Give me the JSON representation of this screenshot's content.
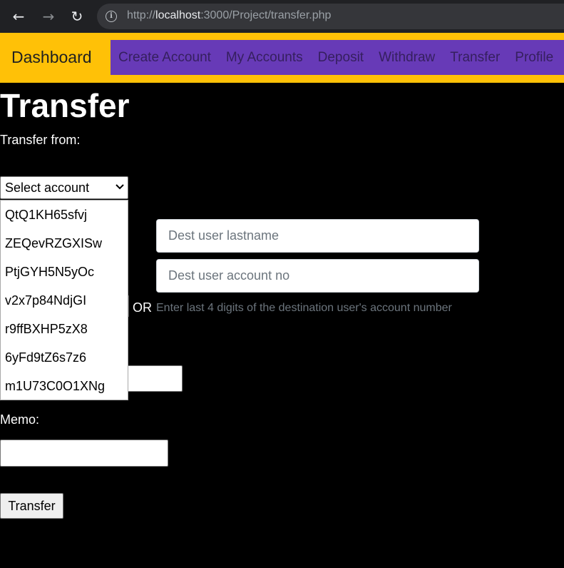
{
  "browser": {
    "back_icon": "←",
    "forward_icon": "→",
    "reload_icon": "↻",
    "url_prefix": "http://",
    "url_host": "localhost",
    "url_rest": ":3000/Project/transfer.php"
  },
  "navbar": {
    "brand": "Dashboard",
    "links": [
      "Create Account",
      "My Accounts",
      "Deposit",
      "Withdraw",
      "Transfer",
      "Profile"
    ]
  },
  "page": {
    "title": "Transfer",
    "transfer_from_label": "Transfer from:",
    "select_value": "Select account",
    "account_options": [
      "QtQ1KH65sfvj",
      "ZEQevRZGXISw",
      "PtjGYH5N5yOc",
      "v2x7p84NdjGI",
      "r9ffBXHP5zX8",
      "6yFd9tZ6s7z6",
      "m1U73C0O1XNg"
    ],
    "dest_lastname_placeholder": "Dest user lastname",
    "dest_account_placeholder": "Dest user account no",
    "or_label": "OR",
    "hint": "Enter last 4 digits of the destination user's account number",
    "memo_label": "Memo:",
    "submit_label": "Transfer"
  },
  "colors": {
    "navbar_bg": "#ffc107",
    "nav_links_bg": "#673ab7",
    "page_bg": "#000000"
  }
}
